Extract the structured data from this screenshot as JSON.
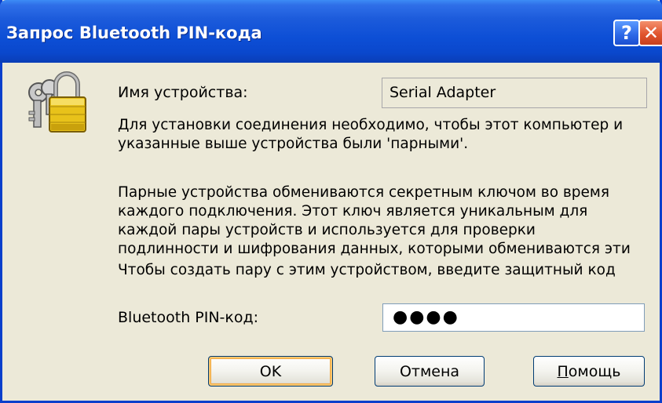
{
  "window": {
    "title": "Запрос Bluetooth PIN-кода",
    "help_glyph": "?",
    "close_glyph": "✕"
  },
  "icons": {
    "dialog_icon": "keys-padlock-icon",
    "help": "help-icon",
    "close": "close-icon"
  },
  "device": {
    "label": "Имя устройства:",
    "value": "Serial Adapter"
  },
  "paragraphs": {
    "pairing_line1": "Для установки соединения необходимо, чтобы этот компьютер и",
    "pairing_line2": "указанные выше устройства были 'парными'.",
    "secret_line1": "Парные устройства обмениваются секретным ключом во время",
    "secret_line2": "каждого подключения. Этот ключ является уникальным для",
    "secret_line3": "каждой пары устройств и используется для проверки",
    "secret_line4": "подлинности и шифрования данных, которыми обмениваются эти",
    "create_pair": "Чтобы создать пару с этим устройством, введите защитный код"
  },
  "pin": {
    "label": "Bluetooth PIN-код:",
    "value": "●●●●"
  },
  "buttons": {
    "ok": "OK",
    "cancel": "Отмена",
    "help_first_letter": "П",
    "help_rest": "омощь"
  },
  "colors": {
    "titlebar": "#0A47CC",
    "dialog_face": "#ECE9D8",
    "close_button": "#E1552E",
    "default_button_focus": "#F2A942"
  }
}
